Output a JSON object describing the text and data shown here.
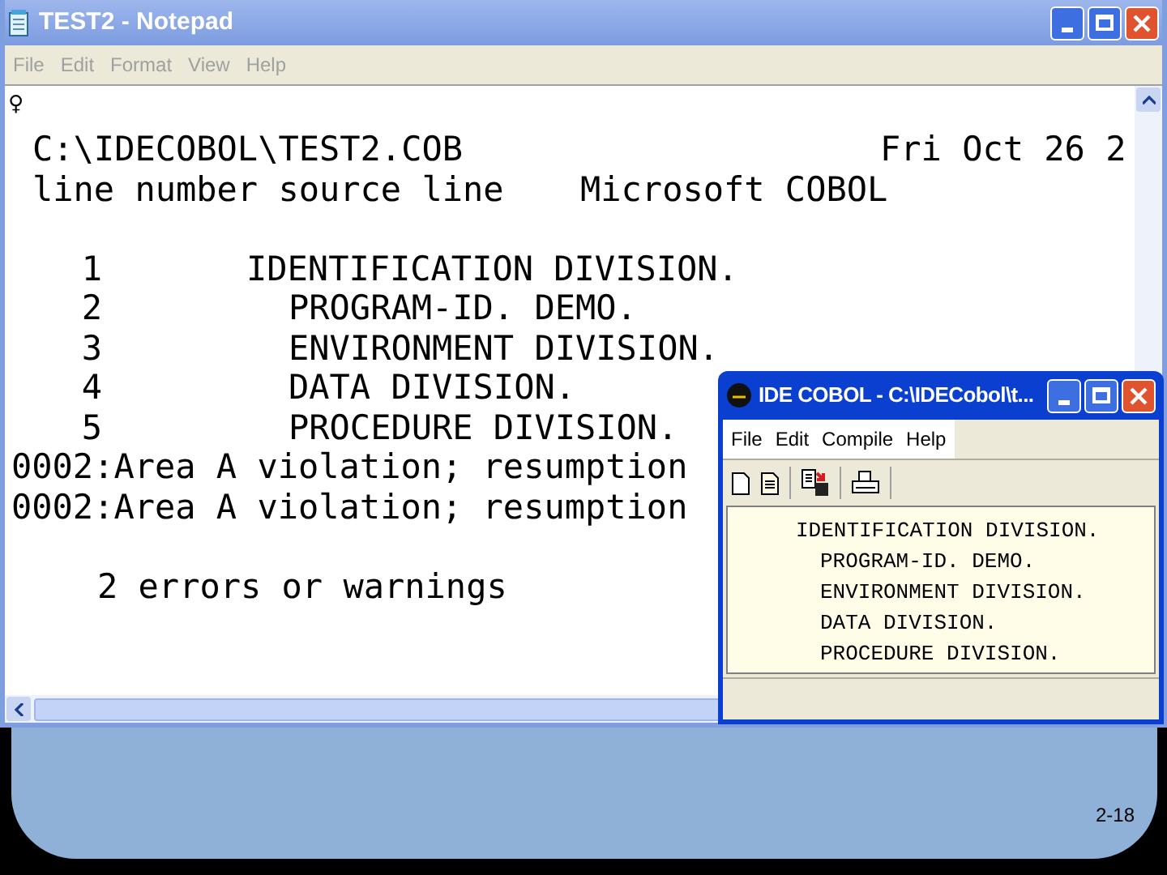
{
  "notepad": {
    "title": "TEST2 - Notepad",
    "menu": [
      "File",
      "Edit",
      "Format",
      "View",
      "Help"
    ],
    "marker": "♀",
    "header": {
      "path": "C:\\IDECOBOL\\TEST2.COB",
      "date": "Fri Oct 26 2",
      "columns": "line number source line",
      "compiler": "Microsoft COBOL"
    },
    "listing": [
      {
        "number": "1",
        "code": "IDENTIFICATION DIVISION."
      },
      {
        "number": "2",
        "code": "PROGRAM-ID. DEMO."
      },
      {
        "number": "3",
        "code": "ENVIRONMENT DIVISION."
      },
      {
        "number": "4",
        "code": "DATA DIVISION."
      },
      {
        "number": "5",
        "code": "PROCEDURE DIVISION."
      }
    ],
    "messages": [
      "0002:Area A violation; resumption",
      "0002:Area A violation; resumption"
    ],
    "summary": "2 errors or warnings"
  },
  "ide": {
    "title": "IDE COBOL - C:\\IDECobol\\t...",
    "menu": [
      "File",
      "Edit",
      "Compile",
      "Help"
    ],
    "source": [
      "IDENTIFICATION DIVISION.",
      "PROGRAM-ID. DEMO.",
      "ENVIRONMENT DIVISION.",
      "DATA DIVISION.",
      "PROCEDURE DIVISION."
    ]
  },
  "slide_number": "2-18"
}
